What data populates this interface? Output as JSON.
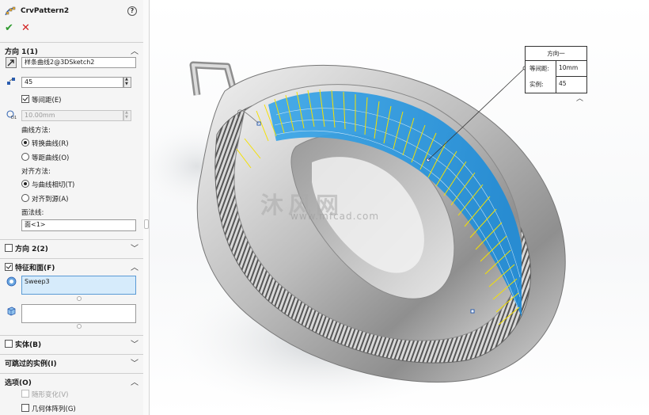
{
  "panel": {
    "title": "CrvPattern2",
    "help_icon": "question-circle-icon",
    "ok_icon": "checkmark-icon",
    "cancel_icon": "x-icon",
    "direction1": {
      "label": "方向 1(1)",
      "curve_field": "样条曲线2@3DSketch2",
      "instances": "45",
      "equal_spacing_label": "等间距(E)",
      "equal_spacing_checked": true,
      "spacing_value": "10.00mm",
      "curve_method_label": "曲线方法:",
      "curve_method_options": [
        "转换曲线(R)",
        "等距曲线(O)"
      ],
      "curve_method_selected": 0,
      "align_method_label": "对齐方法:",
      "align_method_options": [
        "与曲线相切(T)",
        "对齐到源(A)"
      ],
      "align_method_selected": 0,
      "face_normal_label": "面法线:",
      "face_normal_value": "面<1>"
    },
    "direction2": {
      "label": "方向 2(2)",
      "checked": false
    },
    "features_faces": {
      "label": "特征和面(F)",
      "checked": true,
      "feature_item": "Sweep3"
    },
    "bodies": {
      "label": "实体(B)",
      "checked": false
    },
    "skip_instances": {
      "label": "可跳过的实例(I)"
    },
    "options": {
      "label": "选项(O)",
      "vary_sketch_label": "随形变化(V)",
      "geometry_pattern_label": "几何体阵列(G)"
    }
  },
  "viewport": {
    "callout": {
      "title": "方向一",
      "rows": [
        {
          "key": "等间距:",
          "value": "10mm"
        },
        {
          "key": "实例:",
          "value": "45"
        }
      ]
    },
    "watermark": "沐风网",
    "watermark_url": "www.mfcad.com"
  }
}
